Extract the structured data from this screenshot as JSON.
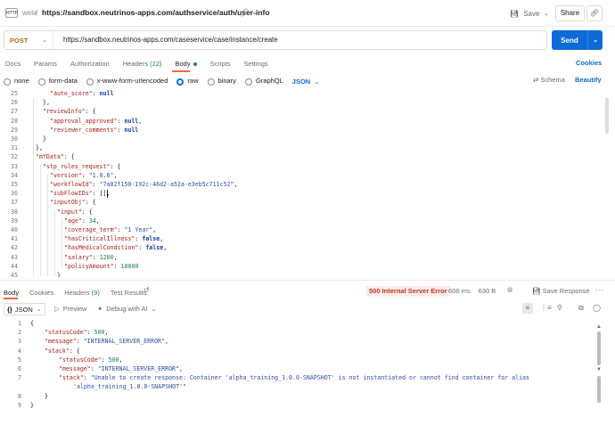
{
  "topbar": {
    "http_badge": "HTTP",
    "workspace": "wela",
    "separator": "/",
    "request_name": "https://sandbox.neutrinos-apps.com/authservice/auth/user-info",
    "save_label": "Save",
    "share_label": "Share"
  },
  "request": {
    "method": "POST",
    "url": "https://sandbox.neutrinos-apps.com/caseservice/case/instance/create",
    "send_label": "Send"
  },
  "request_tabs": [
    {
      "label": "Docs"
    },
    {
      "label": "Params"
    },
    {
      "label": "Authorization"
    },
    {
      "label": "Headers",
      "count": "(22)"
    },
    {
      "label": "Body"
    },
    {
      "label": "Scripts"
    },
    {
      "label": "Settings"
    }
  ],
  "cookies_label": "Cookies",
  "body_modes": [
    "none",
    "form-data",
    "x-www-form-urlencoded",
    "raw",
    "binary",
    "GraphQL"
  ],
  "selected_body_mode": "raw",
  "body_language": "JSON",
  "schema_label": "Schema",
  "beautify_label": "Beautify",
  "editor": {
    "lines": [
      {
        "n": "25",
        "indent": 3,
        "tokens": [
          {
            "t": "k",
            "v": "\"auto_score\""
          },
          {
            "t": "p",
            "v": ": "
          },
          {
            "t": "b",
            "v": "null"
          }
        ]
      },
      {
        "n": "26",
        "indent": 2,
        "tokens": [
          {
            "t": "p",
            "v": "},"
          }
        ]
      },
      {
        "n": "27",
        "indent": 2,
        "tokens": [
          {
            "t": "k",
            "v": "\"reviewInfo\""
          },
          {
            "t": "p",
            "v": ": {"
          }
        ]
      },
      {
        "n": "28",
        "indent": 3,
        "tokens": [
          {
            "t": "k",
            "v": "\"approval_approved\""
          },
          {
            "t": "p",
            "v": ": "
          },
          {
            "t": "b",
            "v": "null"
          },
          {
            "t": "p",
            "v": ","
          }
        ]
      },
      {
        "n": "29",
        "indent": 3,
        "tokens": [
          {
            "t": "k",
            "v": "\"reviewer_comments\""
          },
          {
            "t": "p",
            "v": ": "
          },
          {
            "t": "b",
            "v": "null"
          }
        ]
      },
      {
        "n": "30",
        "indent": 2,
        "tokens": [
          {
            "t": "p",
            "v": "}"
          }
        ]
      },
      {
        "n": "31",
        "indent": 1,
        "tokens": [
          {
            "t": "p",
            "v": "},"
          }
        ]
      },
      {
        "n": "32",
        "indent": 1,
        "tokens": [
          {
            "t": "k",
            "v": "\"mfData\""
          },
          {
            "t": "p",
            "v": ": {"
          }
        ]
      },
      {
        "n": "33",
        "indent": 2,
        "tokens": [
          {
            "t": "k",
            "v": "\"stp_rules_request\""
          },
          {
            "t": "p",
            "v": ": {"
          }
        ]
      },
      {
        "n": "34",
        "indent": 3,
        "tokens": [
          {
            "t": "k",
            "v": "\"version\""
          },
          {
            "t": "p",
            "v": ": "
          },
          {
            "t": "s",
            "v": "\"1.0.6\""
          },
          {
            "t": "p",
            "v": ","
          }
        ]
      },
      {
        "n": "35",
        "indent": 3,
        "tokens": [
          {
            "t": "k",
            "v": "\"workflowId\""
          },
          {
            "t": "p",
            "v": ": "
          },
          {
            "t": "s",
            "v": "\"7a02f150-192c-46d2-a52a-e3eb5c711c52\""
          },
          {
            "t": "p",
            "v": ","
          }
        ]
      },
      {
        "n": "36",
        "indent": 3,
        "tokens": [
          {
            "t": "k",
            "v": "\"subFlowIDs\""
          },
          {
            "t": "p",
            "v": ": [],"
          }
        ]
      },
      {
        "n": "37",
        "indent": 3,
        "tokens": [
          {
            "t": "k",
            "v": "\"inputObj\""
          },
          {
            "t": "p",
            "v": ": {"
          }
        ]
      },
      {
        "n": "38",
        "indent": 4,
        "tokens": [
          {
            "t": "k",
            "v": "\"input\""
          },
          {
            "t": "p",
            "v": ": {"
          }
        ]
      },
      {
        "n": "39",
        "indent": 5,
        "tokens": [
          {
            "t": "k",
            "v": "\"age\""
          },
          {
            "t": "p",
            "v": ": "
          },
          {
            "t": "n",
            "v": "34"
          },
          {
            "t": "p",
            "v": ","
          }
        ]
      },
      {
        "n": "40",
        "indent": 5,
        "tokens": [
          {
            "t": "k",
            "v": "\"coverage_term\""
          },
          {
            "t": "p",
            "v": ": "
          },
          {
            "t": "s",
            "v": "\"1 Year\""
          },
          {
            "t": "p",
            "v": ","
          }
        ]
      },
      {
        "n": "41",
        "indent": 5,
        "tokens": [
          {
            "t": "k",
            "v": "\"hasCriticalIllness\""
          },
          {
            "t": "p",
            "v": ": "
          },
          {
            "t": "b",
            "v": "false"
          },
          {
            "t": "p",
            "v": ","
          }
        ]
      },
      {
        "n": "42",
        "indent": 5,
        "tokens": [
          {
            "t": "k",
            "v": "\"hasMedicalCondition\""
          },
          {
            "t": "p",
            "v": ": "
          },
          {
            "t": "b",
            "v": "false"
          },
          {
            "t": "p",
            "v": ","
          }
        ]
      },
      {
        "n": "43",
        "indent": 5,
        "tokens": [
          {
            "t": "k",
            "v": "\"salary\""
          },
          {
            "t": "p",
            "v": ": "
          },
          {
            "t": "n",
            "v": "1200"
          },
          {
            "t": "p",
            "v": ","
          }
        ]
      },
      {
        "n": "44",
        "indent": 5,
        "tokens": [
          {
            "t": "k",
            "v": "\"policyAmount\""
          },
          {
            "t": "p",
            "v": ": "
          },
          {
            "t": "n",
            "v": "10000"
          }
        ]
      },
      {
        "n": "45",
        "indent": 4,
        "tokens": [
          {
            "t": "p",
            "v": "}"
          }
        ]
      }
    ]
  },
  "response_tabs": [
    {
      "label": "Body"
    },
    {
      "label": "Cookies"
    },
    {
      "label": "Headers",
      "count": "(9)"
    },
    {
      "label": "Test Results"
    }
  ],
  "response": {
    "status": "500 Internal Server Error",
    "time": "606 ms",
    "size": "630 B",
    "save_label": "Save Response",
    "more": "···",
    "format": "JSON",
    "preview_label": "Preview",
    "debug_label": "Debug with AI",
    "lines": [
      {
        "n": "1",
        "indent": 0,
        "tokens": [
          {
            "t": "p",
            "v": "{"
          }
        ]
      },
      {
        "n": "2",
        "indent": 1,
        "tokens": [
          {
            "t": "k",
            "v": "\"statusCode\""
          },
          {
            "t": "p",
            "v": ": "
          },
          {
            "t": "n",
            "v": "500"
          },
          {
            "t": "p",
            "v": ","
          }
        ]
      },
      {
        "n": "3",
        "indent": 1,
        "tokens": [
          {
            "t": "k",
            "v": "\"message\""
          },
          {
            "t": "p",
            "v": ": "
          },
          {
            "t": "s",
            "v": "\"INTERNAL_SERVER_ERROR\""
          },
          {
            "t": "p",
            "v": ","
          }
        ]
      },
      {
        "n": "4",
        "indent": 1,
        "tokens": [
          {
            "t": "k",
            "v": "\"stack\""
          },
          {
            "t": "p",
            "v": ": {"
          }
        ]
      },
      {
        "n": "5",
        "indent": 2,
        "tokens": [
          {
            "t": "k",
            "v": "\"statusCode\""
          },
          {
            "t": "p",
            "v": ": "
          },
          {
            "t": "n",
            "v": "500"
          },
          {
            "t": "p",
            "v": ","
          }
        ]
      },
      {
        "n": "6",
        "indent": 2,
        "tokens": [
          {
            "t": "k",
            "v": "\"message\""
          },
          {
            "t": "p",
            "v": ": "
          },
          {
            "t": "s",
            "v": "\"INTERNAL_SERVER_ERROR\""
          },
          {
            "t": "p",
            "v": ","
          }
        ]
      },
      {
        "n": "7",
        "indent": 2,
        "tokens": [
          {
            "t": "k",
            "v": "\"stack\""
          },
          {
            "t": "p",
            "v": ": "
          },
          {
            "t": "s",
            "v": "\"Unable to create response: Container 'alpha_training_1.0.0-SNAPSHOT' is not instantiated or cannot find container for alias"
          }
        ]
      },
      {
        "n": "",
        "indent": 3,
        "tokens": [
          {
            "t": "s",
            "v": "'alpha_training_1.0.0-SNAPSHOT'\""
          }
        ]
      },
      {
        "n": "8",
        "indent": 1,
        "tokens": [
          {
            "t": "p",
            "v": "}"
          }
        ]
      },
      {
        "n": "9",
        "indent": 0,
        "tokens": [
          {
            "t": "p",
            "v": "}"
          }
        ]
      }
    ]
  }
}
